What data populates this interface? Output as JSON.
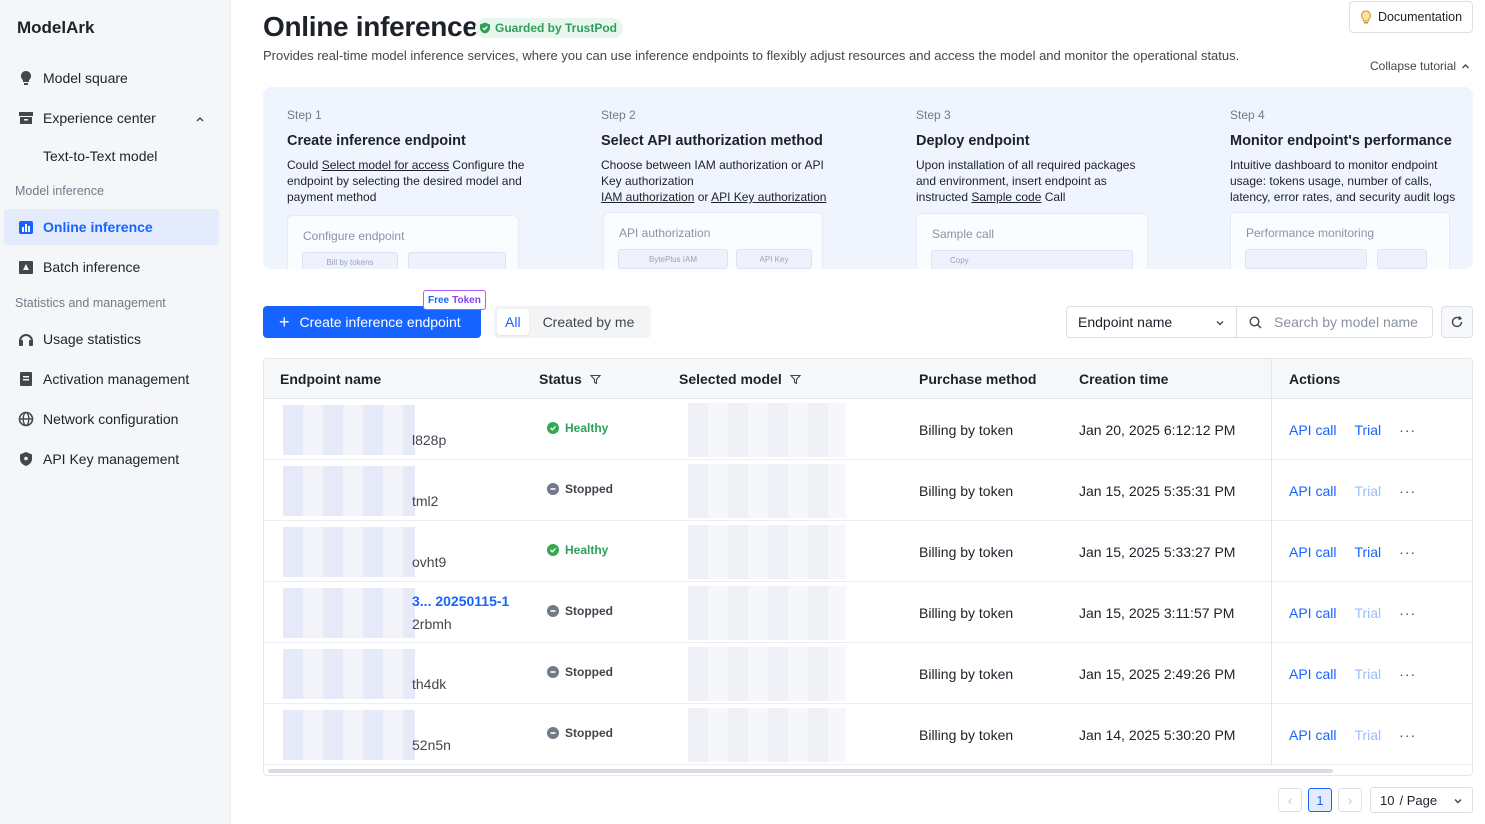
{
  "sidebar": {
    "brand": "ModelArk",
    "items": [
      {
        "label": "Model square"
      },
      {
        "label": "Experience center"
      },
      {
        "label": "Text-to-Text model"
      },
      {
        "label": "Online inference"
      },
      {
        "label": "Batch inference"
      },
      {
        "label": "Usage statistics"
      },
      {
        "label": "Activation management"
      },
      {
        "label": "Network configuration"
      },
      {
        "label": "API Key management"
      }
    ],
    "sections": [
      "Model inference",
      "Statistics and management"
    ]
  },
  "header": {
    "title": "Online inference",
    "badge": "Guarded by TrustPod",
    "subtitle": "Provides real-time model inference services, where you can use inference endpoints to flexibly adjust resources and access the model and monitor the operational status.",
    "doc_button": "Documentation",
    "collapse": "Collapse tutorial"
  },
  "tutorial": {
    "steps": [
      {
        "num": "Step 1",
        "title": "Create inference endpoint",
        "desc_pre": "Could ",
        "desc_link": "Select model for access",
        "desc_post": " Configure the endpoint by selecting the desired model and payment method",
        "card_title": "Configure endpoint",
        "mini_1": "Bill by tokens"
      },
      {
        "num": "Step 2",
        "title": "Select API authorization method",
        "desc_pre": "Choose between IAM authorization or API Key authorization",
        "link_a": "IAM authorization",
        "or": " or ",
        "link_b": "API Key authorization",
        "card_title": "API authorization",
        "mini_1": "BytePlus IAM",
        "mini_2": "API Key"
      },
      {
        "num": "Step 3",
        "title": "Deploy endpoint",
        "desc_pre": "Upon installation of all required packages and environment, insert endpoint as instructed ",
        "desc_link": "Sample code",
        "desc_post": " Call",
        "card_title": "Sample call",
        "mini_1": "Copy"
      },
      {
        "num": "Step 4",
        "title": "Monitor endpoint's performance",
        "desc_pre": "Intuitive dashboard to monitor endpoint usage: tokens usage, number of calls, latency, error rates, and security audit logs",
        "card_title": "Performance monitoring"
      }
    ]
  },
  "toolbar": {
    "create_label": "Create inference endpoint",
    "free_token_a": "Free",
    "free_token_b": "Token",
    "tabs": [
      "All",
      "Created by me"
    ],
    "filter_value": "Endpoint name",
    "search_placeholder": "Search by model name"
  },
  "table": {
    "columns": [
      "Endpoint name",
      "Status",
      "Selected model",
      "Purchase method",
      "Creation time",
      "Actions"
    ],
    "rows": [
      {
        "name": "",
        "id_suffix": "l828p",
        "status": "Healthy",
        "purchase": "Billing by token",
        "created": "Jan 20, 2025 6:12:12 PM",
        "api": "API call",
        "trial": "Trial",
        "trial_enabled": true
      },
      {
        "name": "",
        "id_suffix": "tml2",
        "status": "Stopped",
        "purchase": "Billing by token",
        "created": "Jan 15, 2025 5:35:31 PM",
        "api": "API call",
        "trial": "Trial",
        "trial_enabled": false
      },
      {
        "name": "",
        "id_suffix": "ovht9",
        "status": "Healthy",
        "purchase": "Billing by token",
        "created": "Jan 15, 2025 5:33:27 PM",
        "api": "API call",
        "trial": "Trial",
        "trial_enabled": true
      },
      {
        "name": "3... 20250115-1",
        "id_suffix": "2rbmh",
        "status": "Stopped",
        "purchase": "Billing by token",
        "created": "Jan 15, 2025 3:11:57 PM",
        "api": "API call",
        "trial": "Trial",
        "trial_enabled": false
      },
      {
        "name": "",
        "id_suffix": "th4dk",
        "status": "Stopped",
        "purchase": "Billing by token",
        "created": "Jan 15, 2025 2:49:26 PM",
        "api": "API call",
        "trial": "Trial",
        "trial_enabled": false
      },
      {
        "name": "",
        "id_suffix": "52n5n",
        "status": "Stopped",
        "purchase": "Billing by token",
        "created": "Jan 14, 2025 5:30:20 PM",
        "api": "API call",
        "trial": "Trial",
        "trial_enabled": false
      }
    ],
    "more": "···"
  },
  "pagination": {
    "prev": "‹",
    "current": "1",
    "next": "›",
    "page_size_num": "10",
    "page_size_unit": "/ Page"
  },
  "colors": {
    "accent": "#1664ff",
    "healthy": "#34a853",
    "stopped": "#737a87",
    "trial_disabled": "#9dbdfa"
  }
}
